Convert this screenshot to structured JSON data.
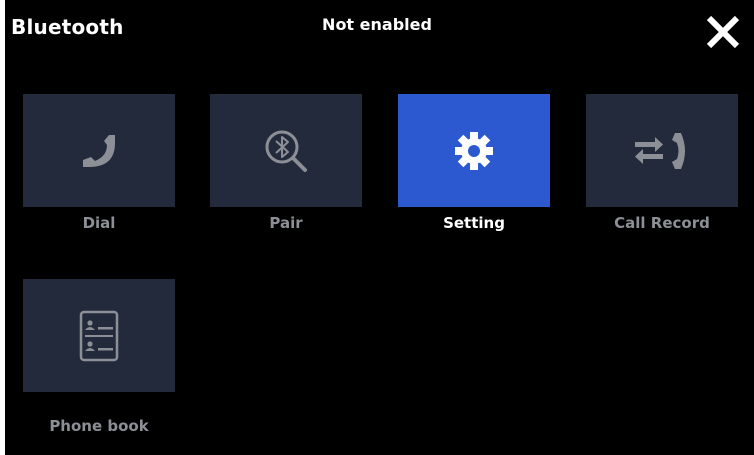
{
  "header": {
    "title": "Bluetooth",
    "status": "Not enabled",
    "close_icon": "close-icon"
  },
  "colors": {
    "background": "#000000",
    "tile": "#232a3b",
    "tile_active": "#2d59d0",
    "icon": "#8c8f95",
    "label_inactive": "#8c8f95",
    "label_active": "#ffffff"
  },
  "menu": {
    "items": [
      {
        "label": "Dial",
        "icon": "phone-icon",
        "selected": false
      },
      {
        "label": "Pair",
        "icon": "bluetooth-search-icon",
        "selected": false
      },
      {
        "label": "Setting",
        "icon": "gear-icon",
        "selected": true
      },
      {
        "label": "Call Record",
        "icon": "call-record-icon",
        "selected": false
      },
      {
        "label": "Phone book",
        "icon": "phonebook-icon",
        "selected": false
      }
    ]
  }
}
